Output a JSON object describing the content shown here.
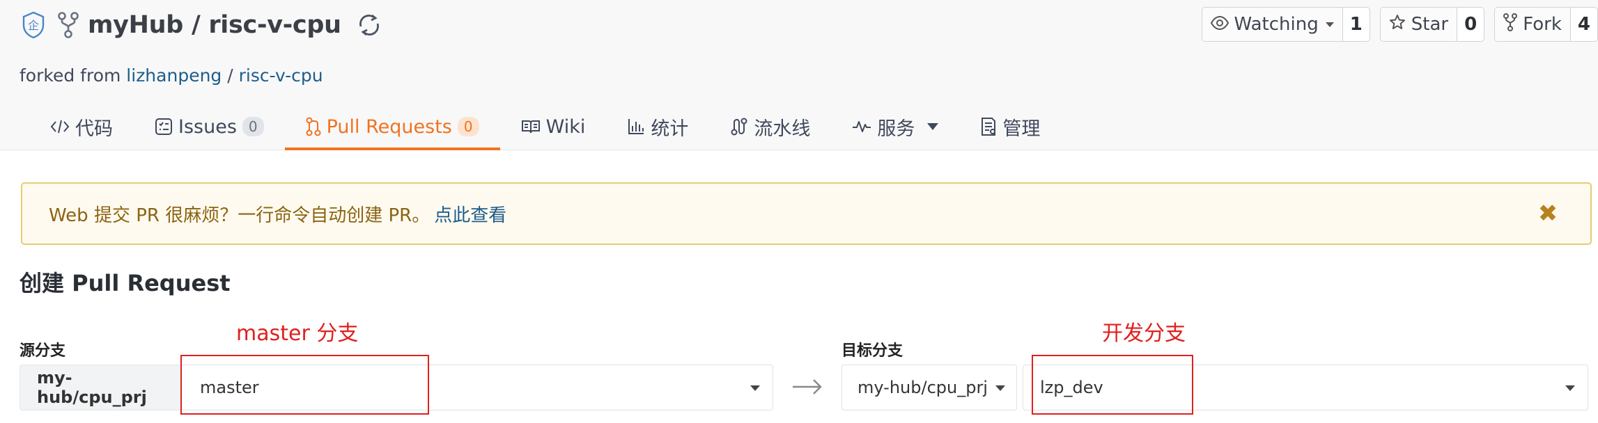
{
  "repo": {
    "owner": "myHub",
    "separator": "/",
    "name": "risc-v-cpu",
    "forked_prefix": "forked from",
    "forked_owner": "lizhanpeng",
    "forked_sep": "/",
    "forked_repo": "risc-v-cpu"
  },
  "actions": {
    "watch_label": "Watching",
    "watch_count": "1",
    "star_label": "Star",
    "star_count": "0",
    "fork_label": "Fork",
    "fork_count": "4"
  },
  "tabs": [
    {
      "label": "代码",
      "icon": "code-icon"
    },
    {
      "label": "Issues",
      "badge": "0",
      "icon": "issues-icon"
    },
    {
      "label": "Pull Requests",
      "badge": "0",
      "icon": "pull-request-icon",
      "active": true
    },
    {
      "label": "Wiki",
      "icon": "book-icon"
    },
    {
      "label": "统计",
      "icon": "chart-icon"
    },
    {
      "label": "流水线",
      "icon": "pipeline-icon"
    },
    {
      "label": "服务",
      "icon": "pulse-icon"
    },
    {
      "label": "管理",
      "icon": "settings-doc-icon"
    }
  ],
  "notice": {
    "text": "Web 提交 PR 很麻烦？一行命令自动创建 PR。",
    "link": "点此查看"
  },
  "page_title": "创建 Pull Request",
  "source": {
    "label": "源分支",
    "repo": "my-hub/cpu_prj",
    "branch": "master",
    "annotation": "master 分支"
  },
  "target": {
    "label": "目标分支",
    "repo": "my-hub/cpu_prj",
    "branch": "lzp_dev",
    "annotation": "开发分支"
  },
  "colors": {
    "accent": "#f07320",
    "link": "#1d5d8a",
    "annotation": "#e0201e",
    "notice_bg": "#fffaf0",
    "notice_border": "#e6cb71"
  }
}
